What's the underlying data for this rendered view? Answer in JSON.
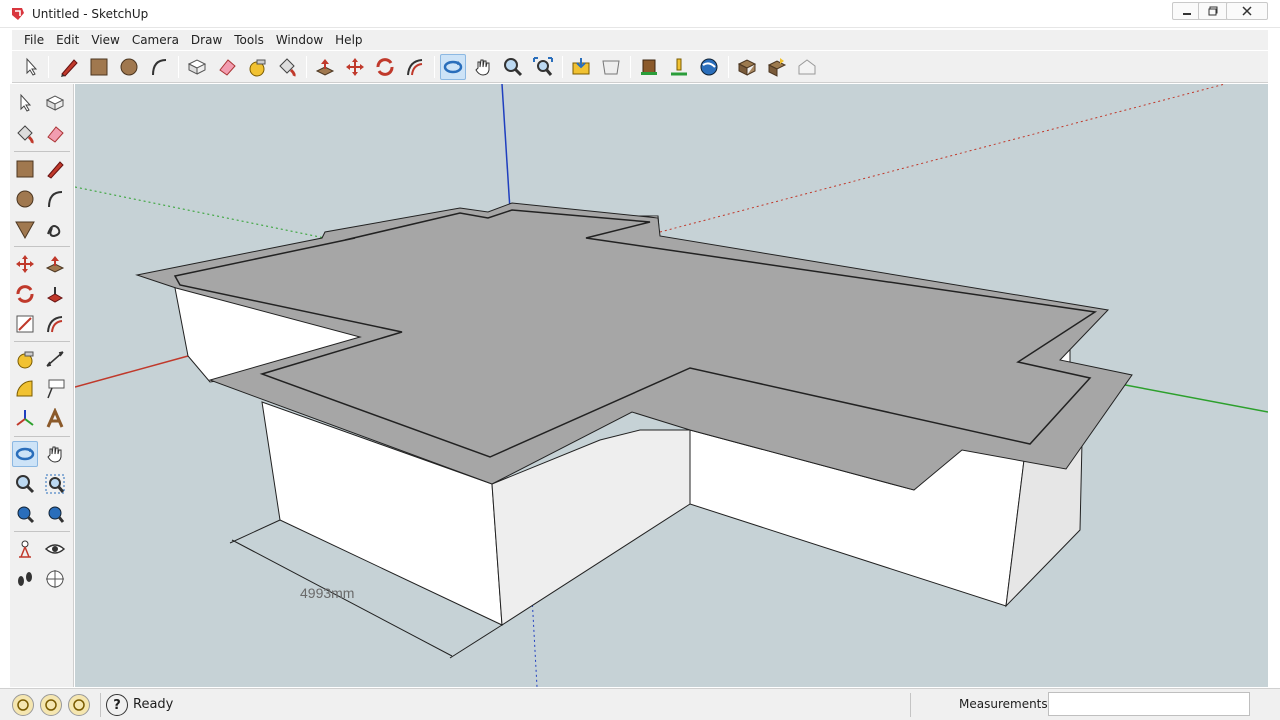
{
  "window": {
    "title": "Untitled - SketchUp"
  },
  "menu": [
    "File",
    "Edit",
    "View",
    "Camera",
    "Draw",
    "Tools",
    "Window",
    "Help"
  ],
  "toolbar_icons": [
    "select-icon",
    "pencil-icon",
    "rectangle-icon",
    "circle-icon",
    "arc-icon",
    "make-component-icon",
    "eraser-icon",
    "tape-measure-icon",
    "paint-bucket-icon",
    "push-pull-icon",
    "move-icon",
    "rotate-icon",
    "offset-icon",
    "orbit-icon",
    "pan-icon",
    "zoom-icon",
    "zoom-extents-icon",
    "get-models-icon",
    "share-model-icon",
    "3d-warehouse-icon",
    "add-location-icon",
    "google-earth-icon",
    "extension-warehouse-icon",
    "share-component-icon",
    "preview-icon"
  ],
  "viewport": {
    "dimension_label": "4993mm",
    "bg_color": "#c6d2d6",
    "roof_color": "#a6a6a6"
  },
  "status": {
    "text": "Ready",
    "measurements_label": "Measurements",
    "measurements_value": ""
  },
  "colors": {
    "axis_red": "#c0392b",
    "axis_green": "#2ca02c",
    "axis_blue": "#1f3fbf",
    "accent": "#3b78c4"
  }
}
